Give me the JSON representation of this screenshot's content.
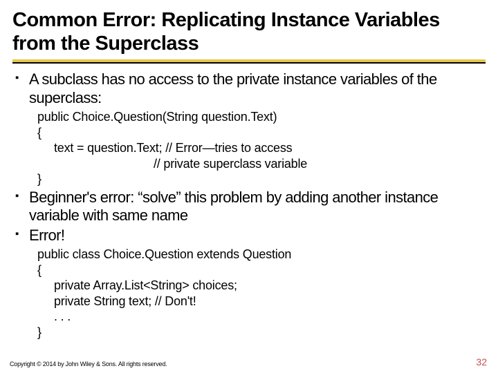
{
  "title": "Common Error: Replicating Instance Variables from the Superclass",
  "bullets": {
    "b1": "A subclass has no access to the private instance variables of the superclass:",
    "b2": "Beginner's error: “solve” this problem by adding another instance variable with same name",
    "b3": "Error!"
  },
  "code1": {
    "l1": "public Choice.Question(String question.Text)",
    "l2": "{",
    "l3": "text = question.Text; // Error—tries to access",
    "l4": "// private superclass variable",
    "l5": "}"
  },
  "code2": {
    "l1": "public class Choice.Question extends Question",
    "l2": "{",
    "l3": "private Array.List<String> choices;",
    "l4": "private String text; // Don't!",
    "l5": ". . .",
    "l6": "}"
  },
  "footer": "Copyright © 2014 by John Wiley & Sons. All rights reserved.",
  "pagenum": "32"
}
